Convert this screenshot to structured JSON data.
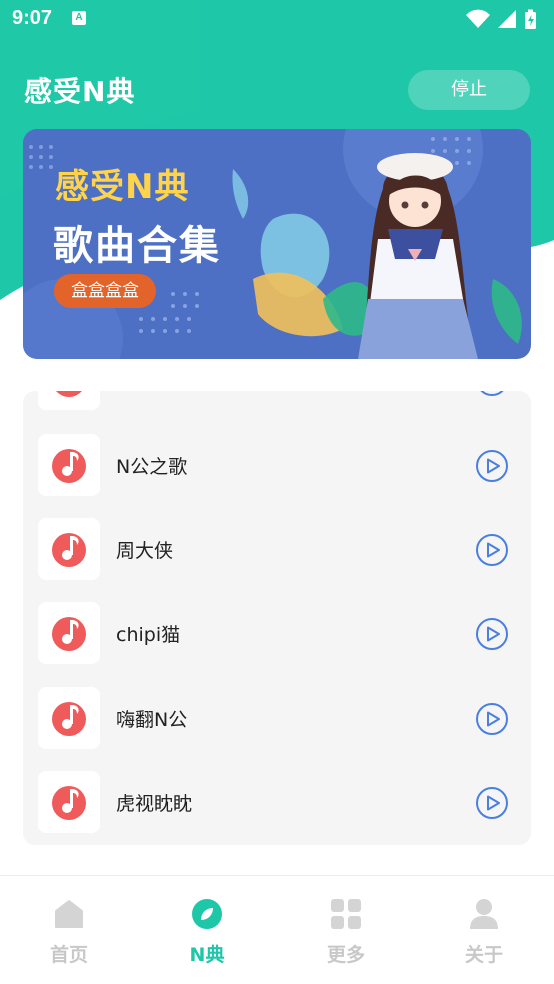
{
  "status_bar": {
    "time": "9:07",
    "notification_glyph": "A"
  },
  "header": {
    "title": "感受N典",
    "stop_label": "停止"
  },
  "banner": {
    "title_line1": "感受N典",
    "title_line2": "歌曲合集",
    "tag": "盒盒盒盒"
  },
  "songs": [
    {
      "name": "N公之歌"
    },
    {
      "name": "周大侠"
    },
    {
      "name": "chipi猫"
    },
    {
      "name": "嗨翻N公"
    },
    {
      "name": "虎视眈眈"
    }
  ],
  "nav": [
    {
      "label": "首页",
      "icon": "home-icon",
      "active": false
    },
    {
      "label": "N典",
      "icon": "compass-icon",
      "active": true
    },
    {
      "label": "更多",
      "icon": "grid-icon",
      "active": false
    },
    {
      "label": "关于",
      "icon": "user-icon",
      "active": false
    }
  ],
  "colors": {
    "accent": "#1ec7a8",
    "song_icon": "#ef5a5a",
    "play_icon": "#4a7fe0",
    "banner_bg": "#4d6fc4",
    "banner_tag": "#e2642b"
  }
}
